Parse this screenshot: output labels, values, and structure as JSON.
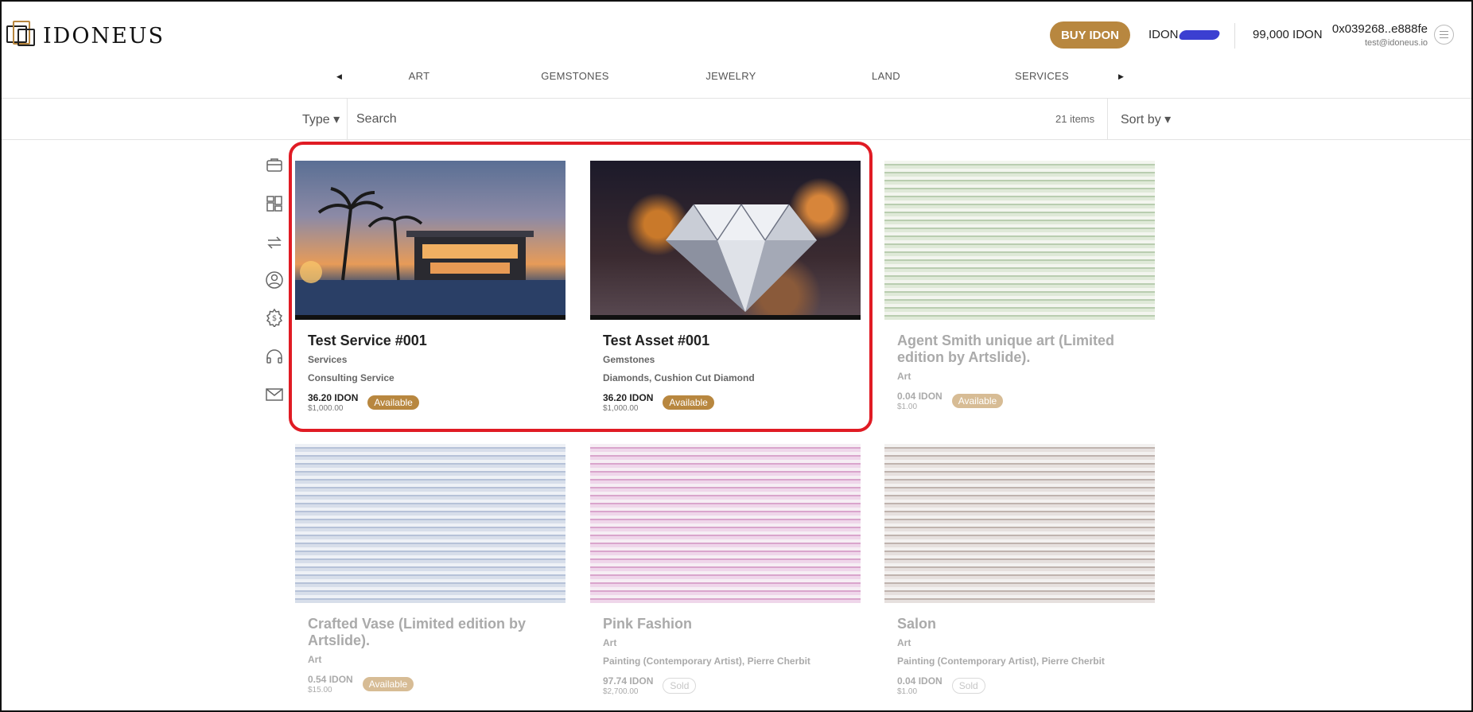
{
  "brand": {
    "name": "IDONEUS",
    "logo_icon": "idoneus-logo-icon"
  },
  "header": {
    "buy_label": "BUY IDON",
    "token_label": "IDON",
    "balance": "99,000 IDON",
    "wallet_address": "0x039268..e888fe",
    "email": "test@idoneus.io"
  },
  "categories": [
    "ART",
    "GEMSTONES",
    "JEWELRY",
    "LAND",
    "SERVICES"
  ],
  "filter": {
    "type_label": "Type ▾",
    "search_placeholder": "Search",
    "items_count": "21 items",
    "sort_label": "Sort by ▾"
  },
  "sidebar": {
    "icons": [
      "briefcase-icon",
      "dashboard-icon",
      "transfer-icon",
      "profile-icon",
      "settings-dollar-icon",
      "support-headset-icon",
      "mail-icon"
    ]
  },
  "cards": [
    {
      "title": "Test Service #001",
      "category": "Services",
      "subtitle": "Consulting Service",
      "price": "36.20 IDON",
      "usd": "$1,000.00",
      "status": "Available"
    },
    {
      "title": "Test Asset #001",
      "category": "Gemstones",
      "subtitle": "Diamonds, Cushion Cut Diamond",
      "price": "36.20 IDON",
      "usd": "$1,000.00",
      "status": "Available"
    },
    {
      "title": "Agent Smith unique art (Limited edition by Artslide).",
      "category": "Art",
      "subtitle": "",
      "price": "0.04 IDON",
      "usd": "$1.00",
      "status": "Available"
    },
    {
      "title": "Crafted Vase (Limited edition by Artslide).",
      "category": "Art",
      "subtitle": "",
      "price": "0.54 IDON",
      "usd": "$15.00",
      "status": "Available"
    },
    {
      "title": "Pink Fashion",
      "category": "Art",
      "subtitle": "Painting (Contemporary Artist), Pierre Cherbit",
      "price": "97.74 IDON",
      "usd": "$2,700.00",
      "status": "Sold"
    },
    {
      "title": "Salon",
      "category": "Art",
      "subtitle": "Painting (Contemporary Artist), Pierre Cherbit",
      "price": "0.04 IDON",
      "usd": "$1.00",
      "status": "Sold"
    }
  ],
  "colors": {
    "accent": "#b8873f",
    "highlight": "#e01b24"
  }
}
